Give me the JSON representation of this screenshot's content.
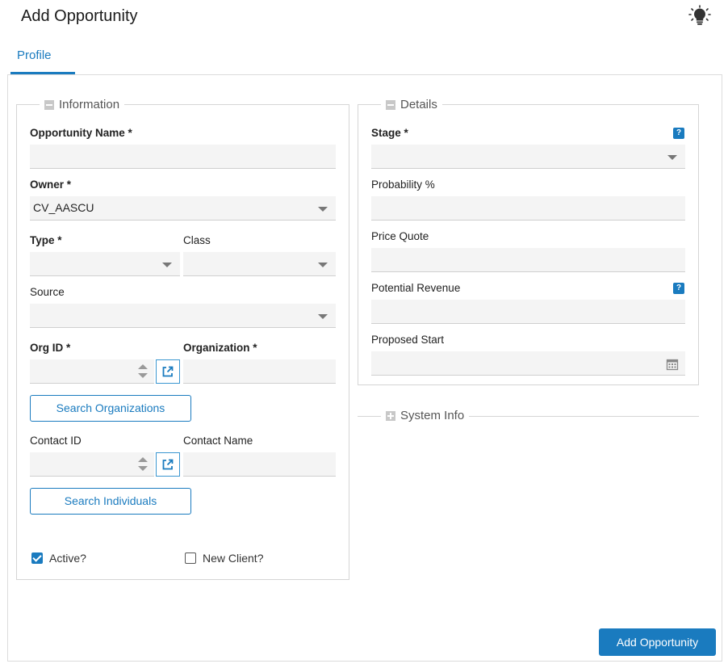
{
  "header": {
    "title": "Add Opportunity",
    "hint_icon": "lightbulb-icon"
  },
  "tabs": [
    {
      "label": "Profile",
      "active": true
    }
  ],
  "information": {
    "legend": "Information",
    "opportunity_name": {
      "label": "Opportunity Name *",
      "value": ""
    },
    "owner": {
      "label": "Owner *",
      "value": "CV_AASCU"
    },
    "type": {
      "label": "Type *",
      "value": ""
    },
    "class": {
      "label": "Class",
      "value": ""
    },
    "source": {
      "label": "Source",
      "value": ""
    },
    "org_id": {
      "label": "Org ID *",
      "value": ""
    },
    "organization": {
      "label": "Organization *",
      "value": ""
    },
    "search_orgs_label": "Search Organizations",
    "contact_id": {
      "label": "Contact ID",
      "value": ""
    },
    "contact_name": {
      "label": "Contact Name",
      "value": ""
    },
    "search_individuals_label": "Search Individuals",
    "active": {
      "label": "Active?",
      "checked": true
    },
    "new_client": {
      "label": "New Client?",
      "checked": false
    }
  },
  "details": {
    "legend": "Details",
    "stage": {
      "label": "Stage *",
      "value": ""
    },
    "probability": {
      "label": "Probability %",
      "value": ""
    },
    "price_quote": {
      "label": "Price Quote",
      "value": ""
    },
    "potential_revenue": {
      "label": "Potential Revenue",
      "value": ""
    },
    "proposed_start": {
      "label": "Proposed Start",
      "value": ""
    },
    "help_glyph": "?"
  },
  "system_info": {
    "legend": "System Info"
  },
  "footer": {
    "submit_label": "Add Opportunity"
  },
  "colors": {
    "accent": "#1a7bbf",
    "field_bg": "#f4f4f4",
    "border": "#d5d5d5"
  }
}
